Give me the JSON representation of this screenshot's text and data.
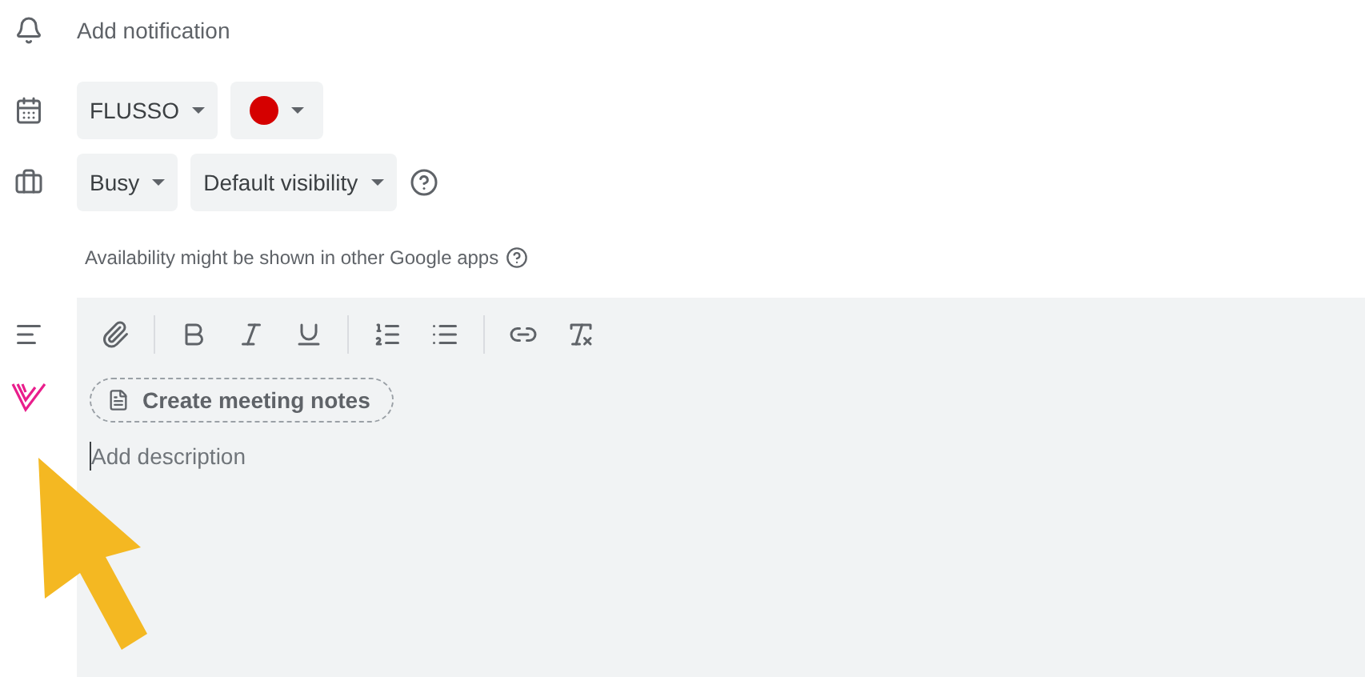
{
  "notification": {
    "label": "Add notification"
  },
  "calendar": {
    "name": "FLUSSO",
    "color": "#d50000"
  },
  "availability": {
    "status": "Busy",
    "visibility": "Default visibility",
    "note": "Availability might be shown in other Google apps"
  },
  "editor": {
    "notes_button": "Create meeting notes",
    "placeholder": "Add description"
  }
}
